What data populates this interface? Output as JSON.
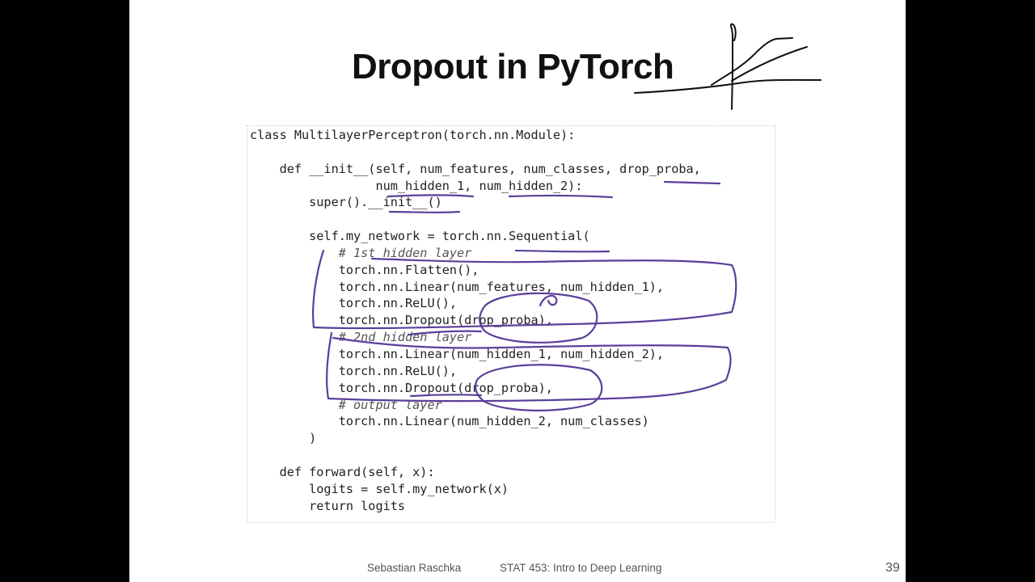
{
  "slide": {
    "title": "Dropout in PyTorch",
    "code_lines": [
      {
        "text": "class MultilayerPerceptron(torch.nn.Module):",
        "kind": "code"
      },
      {
        "text": "",
        "kind": "code"
      },
      {
        "text": "    def __init__(self, num_features, num_classes, drop_proba,",
        "kind": "code"
      },
      {
        "text": "                 num_hidden_1, num_hidden_2):",
        "kind": "code"
      },
      {
        "text": "        super().__init__()",
        "kind": "code"
      },
      {
        "text": "",
        "kind": "code"
      },
      {
        "text": "        self.my_network = torch.nn.Sequential(",
        "kind": "code"
      },
      {
        "text": "            # 1st hidden layer",
        "kind": "comment"
      },
      {
        "text": "            torch.nn.Flatten(),",
        "kind": "code"
      },
      {
        "text": "            torch.nn.Linear(num_features, num_hidden_1),",
        "kind": "code"
      },
      {
        "text": "            torch.nn.ReLU(),",
        "kind": "code"
      },
      {
        "text": "            torch.nn.Dropout(drop_proba),",
        "kind": "code"
      },
      {
        "text": "            # 2nd hidden layer",
        "kind": "comment"
      },
      {
        "text": "            torch.nn.Linear(num_hidden_1, num_hidden_2),",
        "kind": "code"
      },
      {
        "text": "            torch.nn.ReLU(),",
        "kind": "code"
      },
      {
        "text": "            torch.nn.Dropout(drop_proba),",
        "kind": "code"
      },
      {
        "text": "            # output layer",
        "kind": "comment"
      },
      {
        "text": "            torch.nn.Linear(num_hidden_2, num_classes)",
        "kind": "code"
      },
      {
        "text": "        )",
        "kind": "code"
      },
      {
        "text": "",
        "kind": "code"
      },
      {
        "text": "    def forward(self, x):",
        "kind": "code"
      },
      {
        "text": "        logits = self.my_network(x)",
        "kind": "code"
      },
      {
        "text": "        return logits",
        "kind": "code"
      }
    ],
    "footer": {
      "author": "Sebastian Raschka",
      "course": "STAT 453: Intro to Deep Learning",
      "page_number": "39"
    }
  },
  "colors": {
    "background": "#000000",
    "slide": "#ffffff",
    "annotation_ink": "#5a3f9a",
    "sketch_ink": "#111111"
  }
}
